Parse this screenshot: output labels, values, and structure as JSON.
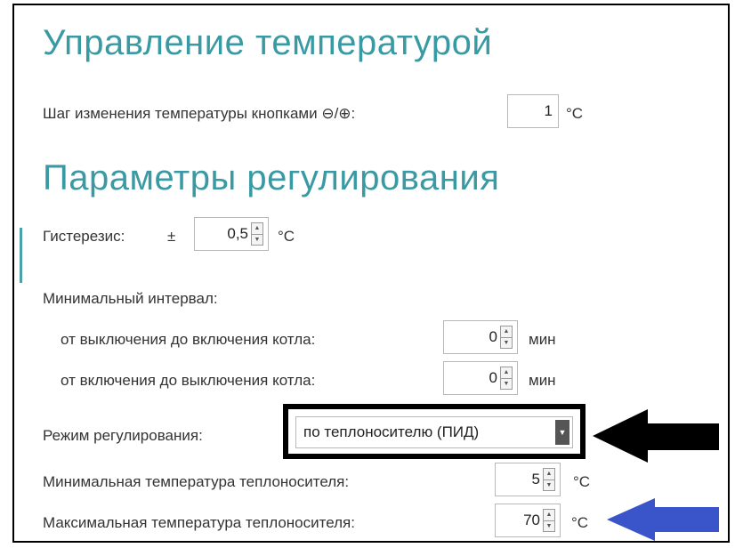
{
  "temperature_control": {
    "title": "Управление температурой",
    "step_label": "Шаг изменения температуры кнопками ⊖/⊕:",
    "step_value": "1",
    "step_unit": "°C"
  },
  "regulation": {
    "title": "Параметры регулирования",
    "hysteresis_label": "Гистерезис:",
    "hysteresis_sign": "±",
    "hysteresis_value": "0,5",
    "hysteresis_unit": "°C",
    "min_interval_label": "Минимальный интервал:",
    "off_to_on_label": "от выключения до включения котла:",
    "off_to_on_value": "0",
    "off_to_on_unit": "мин",
    "on_to_off_label": "от включения до выключения котла:",
    "on_to_off_value": "0",
    "on_to_off_unit": "мин",
    "mode_label": "Режим регулирования:",
    "mode_value": "по теплоносителю (ПИД)",
    "min_coolant_label": "Минимальная температура теплоносителя:",
    "min_coolant_value": "5",
    "min_coolant_unit": "°C",
    "max_coolant_label": "Максимальная температура теплоносителя:",
    "max_coolant_value": "70",
    "max_coolant_unit": "°C"
  },
  "annotations": {
    "black_arrow_color": "#000000",
    "blue_arrow_color": "#3a55c9"
  }
}
